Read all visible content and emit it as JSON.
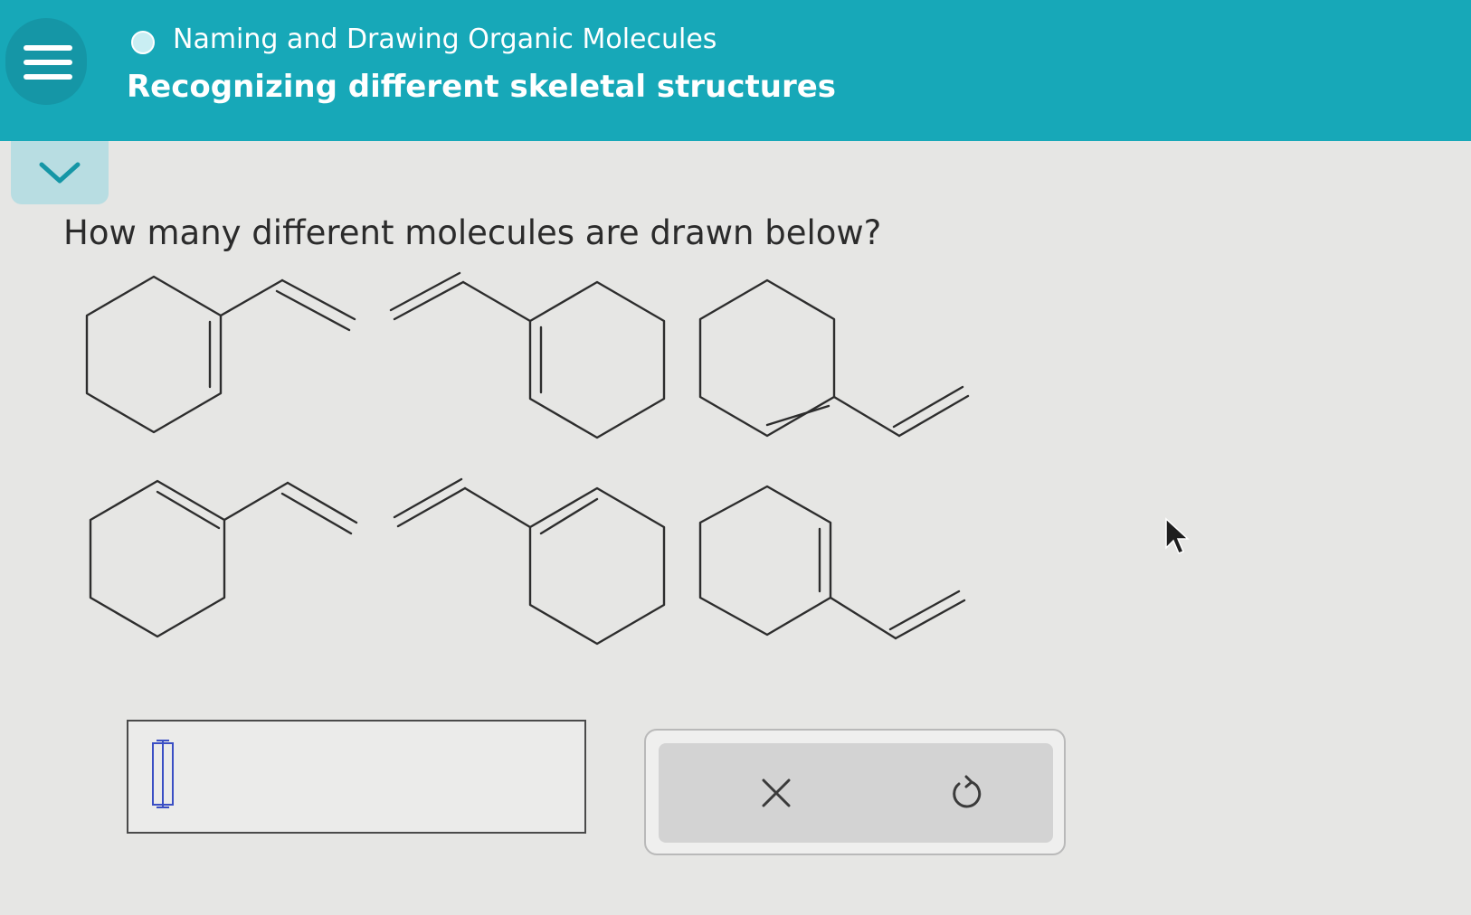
{
  "header": {
    "topic_title": "Naming and Drawing Organic Molecules",
    "page_title": "Recognizing different skeletal structures",
    "menu_icon": "hamburger-menu-icon",
    "status_icon": "progress-circle-icon",
    "background_color": "#17a8b8"
  },
  "collapse": {
    "icon": "chevron-down-icon"
  },
  "question": {
    "text": "How many different molecules are drawn below?"
  },
  "molecules": {
    "count_drawn": 6,
    "structures": [
      "vinylcyclohexene",
      "vinylcyclohexene",
      "vinylcyclohexene",
      "vinylcyclohexene",
      "vinylcyclohexene",
      "vinylcyclohexene"
    ]
  },
  "answer": {
    "value": "",
    "cursor_icon": "text-cursor-icon"
  },
  "toolbar": {
    "clear_icon": "close-x-icon",
    "undo_icon": "undo-icon"
  },
  "pointer_icon": "mouse-pointer-icon"
}
